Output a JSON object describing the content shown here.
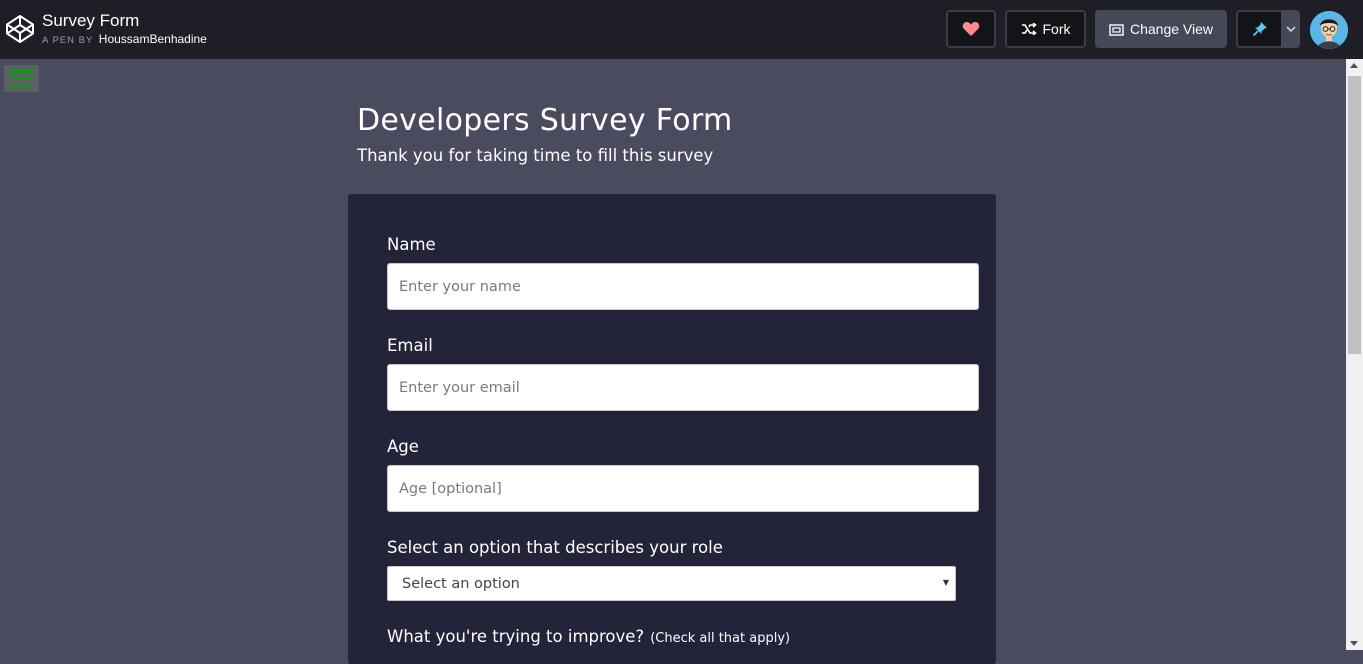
{
  "header": {
    "pen_title": "Survey Form",
    "pen_by_label": "A PEN BY",
    "author": "HoussamBenhadine",
    "fork_label": "Fork",
    "change_view_label": "Change View"
  },
  "survey": {
    "title": "Developers Survey Form",
    "description": "Thank you for taking time to fill this survey"
  },
  "form": {
    "name_label": "Name",
    "name_placeholder": "Enter your name",
    "email_label": "Email",
    "email_placeholder": "Enter your email",
    "age_label": "Age",
    "age_placeholder": "Age [optional]",
    "role_label": "Select an option that describes your role",
    "role_selected": "Select an option",
    "improve_label": "What you're trying to improve?",
    "improve_hint": "(Check all that apply)"
  },
  "colors": {
    "page_bg": "#4a4b5e",
    "card_bg": "#23243a",
    "header_bg": "#1e1f26",
    "menu_green": "#0e9a0e"
  }
}
